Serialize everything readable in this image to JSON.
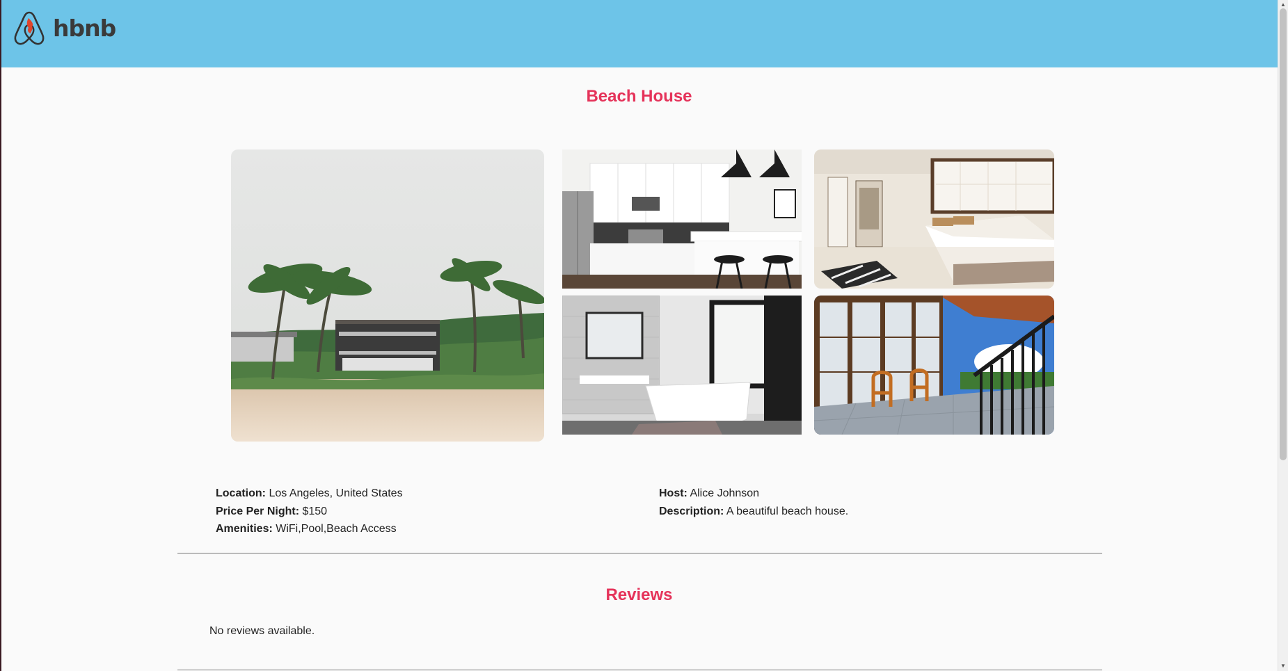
{
  "header": {
    "logo_text": "hbnb",
    "background": "#6dc4e8"
  },
  "place": {
    "title": "Beach House",
    "title_color": "#e5335a",
    "photos": [
      "beach-house-exterior",
      "kitchen",
      "bedroom",
      "bathroom",
      "balcony"
    ]
  },
  "details": {
    "location_label": "Location:",
    "location_value": "Los Angeles, United States",
    "price_label": "Price Per Night:",
    "price_value": "$150",
    "amenities_label": "Amenities:",
    "amenities_value": "WiFi,Pool,Beach Access",
    "host_label": "Host:",
    "host_value": "Alice Johnson",
    "description_label": "Description:",
    "description_value": "A beautiful beach house."
  },
  "reviews": {
    "title": "Reviews",
    "empty_text": "No reviews available."
  }
}
